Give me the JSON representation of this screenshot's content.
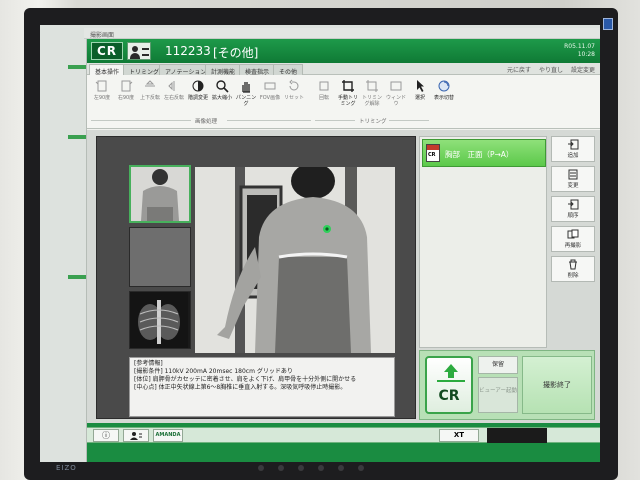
{
  "background_window": {
    "title": "撮影画面"
  },
  "header": {
    "logo": "CR",
    "patient_id": "112233",
    "patient_category": "[その他]",
    "version": "R05.11.07",
    "time": "10:28"
  },
  "tabs": [
    {
      "label": "基本操作",
      "active": true
    },
    {
      "label": "トリミング",
      "active": false
    },
    {
      "label": "アノテーション",
      "active": false
    },
    {
      "label": "計測機能",
      "active": false
    },
    {
      "label": "検査指示",
      "active": false
    },
    {
      "label": "その他",
      "active": false
    }
  ],
  "tab_links": [
    "元に戻す",
    "やり直し",
    "設定変更"
  ],
  "toolbar": {
    "tools": [
      {
        "label": "左90度",
        "icon": "rotate-left-icon",
        "enabled": false
      },
      {
        "label": "右90度",
        "icon": "rotate-right-icon",
        "enabled": false
      },
      {
        "label": "上下反転",
        "icon": "flip-vertical-icon",
        "enabled": false
      },
      {
        "label": "左右反転",
        "icon": "flip-horizontal-icon",
        "enabled": false
      },
      {
        "label": "階調変更",
        "icon": "contrast-icon",
        "enabled": true
      },
      {
        "label": "拡大縮小",
        "icon": "magnifier-icon",
        "enabled": true
      },
      {
        "label": "パンニング",
        "icon": "hand-icon",
        "enabled": true
      },
      {
        "label": "FOV画像",
        "icon": "fov-icon",
        "enabled": false
      },
      {
        "label": "リセット",
        "icon": "reset-icon",
        "enabled": false
      },
      {
        "label": "回転",
        "icon": "rotate-icon",
        "enabled": false
      },
      {
        "label": "手動トリミング",
        "icon": "crop-icon",
        "enabled": true
      },
      {
        "label": "トリミング解除",
        "icon": "crop-release-icon",
        "enabled": false
      },
      {
        "label": "ウィンドウ",
        "icon": "window-icon",
        "enabled": false
      },
      {
        "label": "選択",
        "icon": "select-icon",
        "enabled": true
      },
      {
        "label": "表示切替",
        "icon": "display-toggle-icon",
        "enabled": true
      }
    ],
    "group_image": "画像処理",
    "group_trim": "トリミング"
  },
  "info_panel": {
    "lines": [
      "[参考情報]",
      "[撮影条件] 110kV 200mA 20msec 180cm グリッドあり",
      "[体位] 肩胛骨がカセッテに密着させ、肩をよく下げ、肩甲骨を十分外側に開かせる",
      "[中心点] 体正中矢状線上第6〜8胸椎に垂直入射する。深吸気呼吸停止時撮影。"
    ]
  },
  "exam_list": {
    "items": [
      {
        "icon_text": "CR",
        "label": "胸部　正面（P→A）",
        "selected": true
      }
    ]
  },
  "side_buttons": [
    {
      "label": "追加",
      "icon": "add-icon"
    },
    {
      "label": "変更",
      "icon": "change-icon"
    },
    {
      "label": "順序",
      "icon": "order-icon"
    },
    {
      "label": "再撮影",
      "icon": "retake-icon"
    },
    {
      "label": "削除",
      "icon": "trash-icon"
    }
  ],
  "bottom": {
    "cr_label": "CR",
    "hold_label": "保留",
    "viewer_label": "ビューアー起動",
    "finish_label": "撮影終了"
  },
  "statusbar": {
    "info_icon": "ⓘ",
    "brand": "AMANDA",
    "xt_label": "XT"
  }
}
